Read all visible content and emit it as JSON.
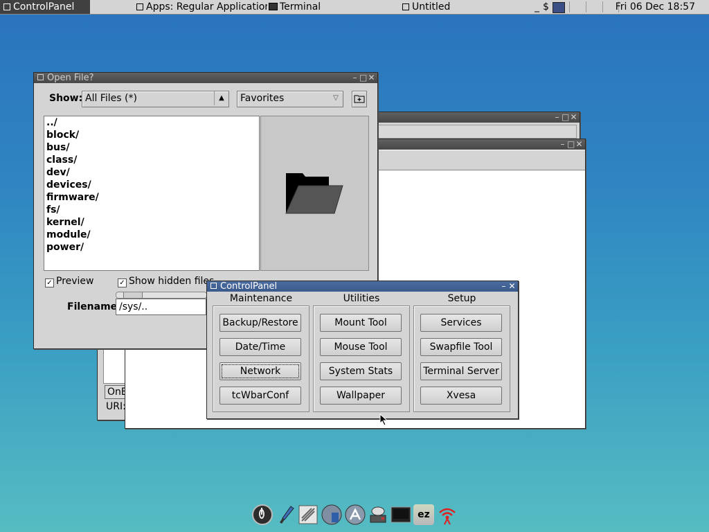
{
  "taskbar": {
    "tasks": [
      {
        "label": "ControlPanel",
        "active": true
      },
      {
        "label": "Apps: Regular Applications"
      },
      {
        "label": "Terminal"
      },
      {
        "label": "Untitled"
      }
    ],
    "tray_underscore": "_",
    "tray_dollar": "$",
    "clock": "Fri 06 Dec 18:57"
  },
  "open_file": {
    "title": "Open File?",
    "show_label": "Show:",
    "filter_value": "All Files (*)",
    "favorites_value": "Favorites",
    "files": [
      "../",
      "block/",
      "bus/",
      "class/",
      "dev/",
      "devices/",
      "firmware/",
      "fs/",
      "kernel/",
      "module/",
      "power/"
    ],
    "preview_label": "Preview",
    "show_hidden_label": "Show hidden files",
    "filename_label": "Filename:",
    "filename_value": "/sys/.."
  },
  "back_window": {
    "partial_button": "OnE",
    "partial_label": "URI:"
  },
  "control_panel": {
    "title": "ControlPanel",
    "groups": [
      {
        "heading": "Maintenance",
        "buttons": [
          "Backup/Restore",
          "Date/Time",
          "Network",
          "tcWbarConf"
        ]
      },
      {
        "heading": "Utilities",
        "buttons": [
          "Mount Tool",
          "Mouse Tool",
          "System Stats",
          "Wallpaper"
        ]
      },
      {
        "heading": "Setup",
        "buttons": [
          "Services",
          "Swapfile Tool",
          "Terminal Server",
          "Xvesa"
        ]
      }
    ]
  },
  "dock": {
    "icons": [
      "power-icon",
      "paint-brush-icon",
      "settings-icon",
      "apps-browser-icon",
      "control-panel-icon",
      "mount-icon",
      "terminal-icon",
      "ezremaster-icon",
      "wifi-icon"
    ],
    "ez_label": "ez"
  },
  "colors": {
    "accent": "#3a5a8c",
    "desktop_top": "#2a73bd",
    "desktop_bottom": "#56bcc2"
  }
}
